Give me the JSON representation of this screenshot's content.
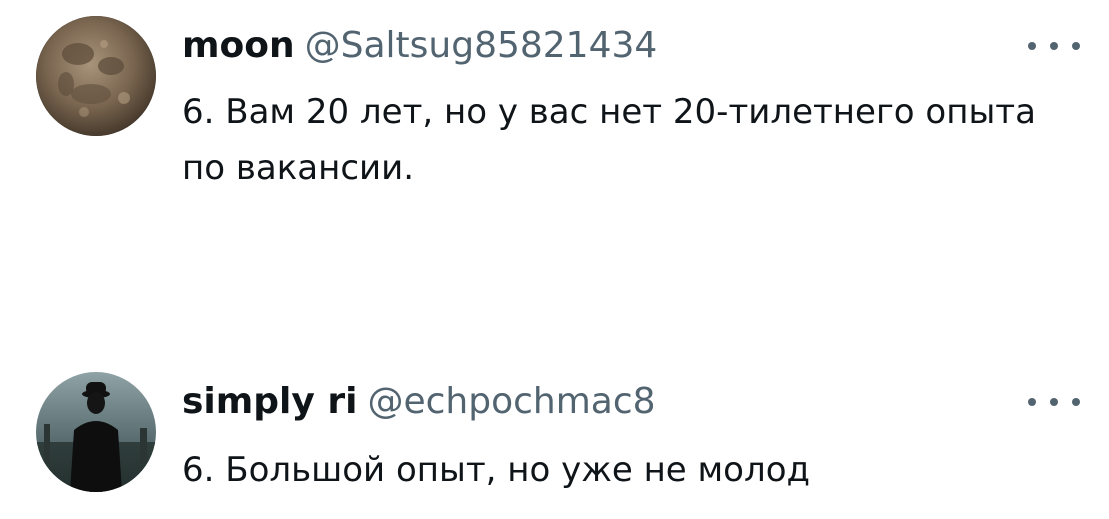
{
  "colors": {
    "text": "#0f1419",
    "secondary": "#536471",
    "background": "#ffffff"
  },
  "tweets": [
    {
      "avatar": "moon-avatar",
      "name": "moon",
      "handle": "@Saltsug85821434",
      "more_icon": "more-horizontal-icon",
      "text": "6. Вам 20 лет, но у вас нет 20-тилетнего опыта по вакансии."
    },
    {
      "avatar": "silhouette-avatar",
      "name": "simply ri",
      "handle": "@echpochmac8",
      "more_icon": "more-horizontal-icon",
      "text": "6. Большой опыт, но уже не молод"
    }
  ]
}
